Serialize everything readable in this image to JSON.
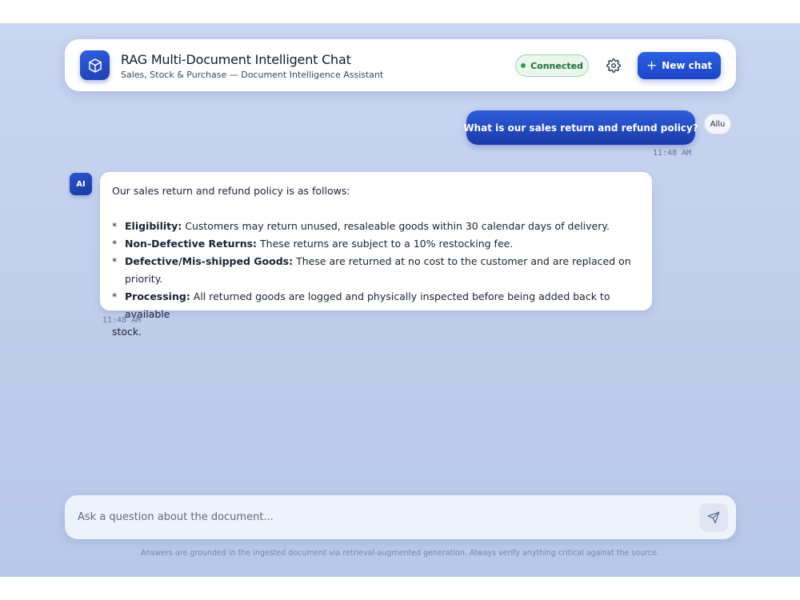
{
  "header": {
    "title": "RAG Multi-Document Intelligent Chat",
    "subtitle": "Sales, Stock & Purchase — Document Intelligence Assistant",
    "status": "Connected",
    "new_chat_label": "New chat",
    "logo_icon": "cube-icon",
    "settings_icon": "gear-icon"
  },
  "messages": {
    "user": {
      "text": "What is our sales return and refund policy?",
      "avatar": "Allu",
      "time": "11:48 AM"
    },
    "ai": {
      "avatar": "AI",
      "intro": "Our sales return and refund policy is as follows:",
      "bullets": [
        {
          "label": "Eligibility:",
          "text": " Customers may return unused, resaleable goods within 30 calendar days of delivery."
        },
        {
          "label": "Non-Defective Returns:",
          "text": " These returns are subject to a 10% restocking fee."
        },
        {
          "label": "Defective/Mis-shipped Goods:",
          "text": " These are returned at no cost to the customer and are replaced on priority."
        },
        {
          "label": "Processing:",
          "text": " All returned goods are logged and physically inspected before being added back to available"
        }
      ],
      "continuation": "stock.",
      "time": "11:48 AM"
    }
  },
  "composer": {
    "placeholder": "Ask a question about the document...",
    "value": "",
    "send_icon": "send-icon"
  },
  "disclaimer": "Answers are grounded in the ingested document via retrieval-augmented generation. Always verify anything critical against the source.",
  "colors": {
    "accent": "#1d45c6",
    "status_green": "#22a04b",
    "background": "#c9d6f1"
  }
}
